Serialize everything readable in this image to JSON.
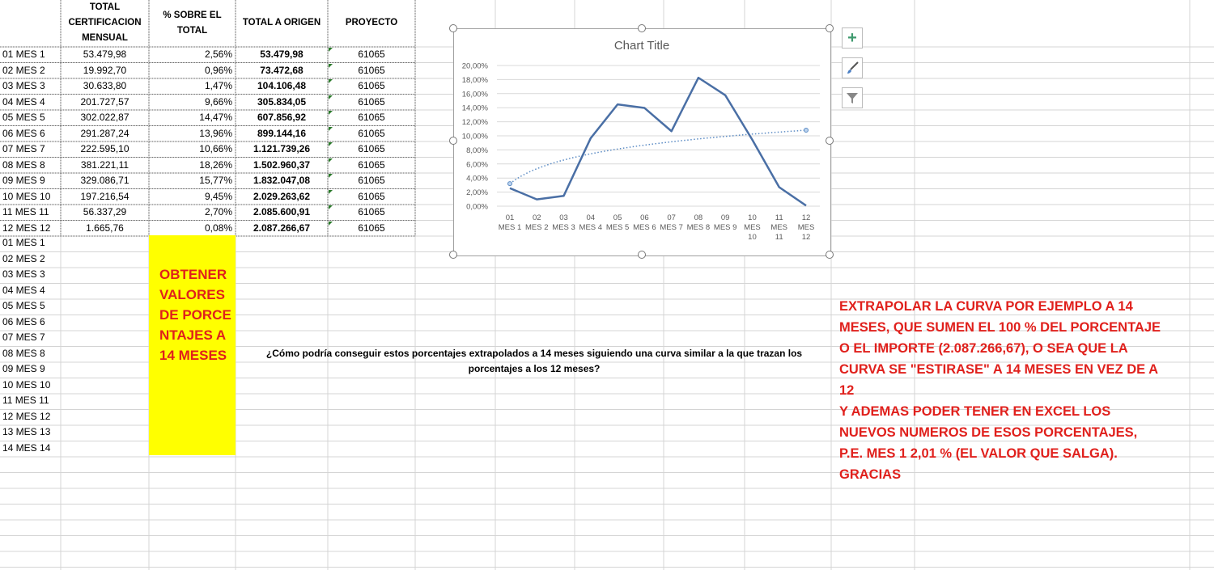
{
  "headers": {
    "col_b": "TOTAL CERTIFICACION MENSUAL",
    "col_c": "% SOBRE EL TOTAL",
    "col_d": "TOTAL  A ORIGEN",
    "col_e": "PROYECTO"
  },
  "rows": [
    {
      "label": "01 MES 1",
      "cert": "53.479,98",
      "pct": "2,56%",
      "origen": "53.479,98",
      "proyecto": "61065"
    },
    {
      "label": "02 MES 2",
      "cert": "19.992,70",
      "pct": "0,96%",
      "origen": "73.472,68",
      "proyecto": "61065"
    },
    {
      "label": "03 MES 3",
      "cert": "30.633,80",
      "pct": "1,47%",
      "origen": "104.106,48",
      "proyecto": "61065"
    },
    {
      "label": "04 MES 4",
      "cert": "201.727,57",
      "pct": "9,66%",
      "origen": "305.834,05",
      "proyecto": "61065"
    },
    {
      "label": "05 MES 5",
      "cert": "302.022,87",
      "pct": "14,47%",
      "origen": "607.856,92",
      "proyecto": "61065"
    },
    {
      "label": "06 MES 6",
      "cert": "291.287,24",
      "pct": "13,96%",
      "origen": "899.144,16",
      "proyecto": "61065"
    },
    {
      "label": "07 MES 7",
      "cert": "222.595,10",
      "pct": "10,66%",
      "origen": "1.121.739,26",
      "proyecto": "61065"
    },
    {
      "label": "08 MES 8",
      "cert": "381.221,11",
      "pct": "18,26%",
      "origen": "1.502.960,37",
      "proyecto": "61065"
    },
    {
      "label": "09 MES 9",
      "cert": "329.086,71",
      "pct": "15,77%",
      "origen": "1.832.047,08",
      "proyecto": "61065"
    },
    {
      "label": "10 MES 10",
      "cert": "197.216,54",
      "pct": "9,45%",
      "origen": "2.029.263,62",
      "proyecto": "61065"
    },
    {
      "label": "11 MES 11",
      "cert": "56.337,29",
      "pct": "2,70%",
      "origen": "2.085.600,91",
      "proyecto": "61065"
    },
    {
      "label": "12 MES 12",
      "cert": "1.665,76",
      "pct": "0,08%",
      "origen": "2.087.266,67",
      "proyecto": "61065"
    }
  ],
  "extra_labels": [
    "01 MES 1",
    "02 MES 2",
    "03 MES 3",
    "04 MES 4",
    "05 MES 5",
    "06 MES 6",
    "07 MES 7",
    "08 MES 8",
    "09 MES 9",
    "10 MES 10",
    "11 MES 11",
    "12 MES 12",
    "13 MES 13",
    "14 MES 14"
  ],
  "yellow_note": "OBTENER VALORES DE PORCENTAJES A 14 MESES",
  "question": "¿Cómo podría conseguir estos porcentajes extrapolados a 14 meses siguiendo una curva similar a la que trazan los porcentajes a los 12 meses?",
  "red_note": [
    "EXTRAPOLAR LA CURVA POR EJEMPLO A 14 MESES, QUE SUMEN EL 100 % DEL PORCENTAJE O EL IMPORTE (2.087.266,67), O SEA QUE LA CURVA SE \"ESTIRASE\" A 14 MESES EN VEZ DE A 12",
    "Y ADEMAS PODER TENER EN EXCEL LOS NUEVOS NUMEROS DE ESOS PORCENTAJES, P.E. MES 1 2,01 % (EL VALOR QUE SALGA). GRACIAS"
  ],
  "chart_buttons": [
    "plus-icon",
    "brush-icon",
    "filter-icon"
  ],
  "colors": {
    "line": "#4a6fa5",
    "trend": "#5b8bc4",
    "note_red": "#e0201c",
    "highlight": "#ffff00"
  },
  "chart_data": {
    "type": "line",
    "title": "Chart Title",
    "categories": [
      [
        "01",
        "MES 1"
      ],
      [
        "02",
        "MES 2"
      ],
      [
        "03",
        "MES 3"
      ],
      [
        "04",
        "MES 4"
      ],
      [
        "05",
        "MES 5"
      ],
      [
        "06",
        "MES 6"
      ],
      [
        "07",
        "MES 7"
      ],
      [
        "08",
        "MES 8"
      ],
      [
        "09",
        "MES 9"
      ],
      [
        "10",
        "MES",
        "10"
      ],
      [
        "11",
        "MES",
        "11"
      ],
      [
        "12",
        "MES",
        "12"
      ]
    ],
    "values": [
      2.56,
      0.96,
      1.47,
      9.66,
      14.47,
      13.96,
      10.66,
      18.26,
      15.77,
      9.45,
      2.7,
      0.08
    ],
    "ylim": [
      0,
      20
    ],
    "yticks": [
      "0,00%",
      "2,00%",
      "4,00%",
      "6,00%",
      "8,00%",
      "10,00%",
      "12,00%",
      "14,00%",
      "16,00%",
      "18,00%",
      "20,00%"
    ],
    "grid": true,
    "trendline": {
      "type": "logarithmic",
      "start": 3.2,
      "end": 10.8
    }
  }
}
